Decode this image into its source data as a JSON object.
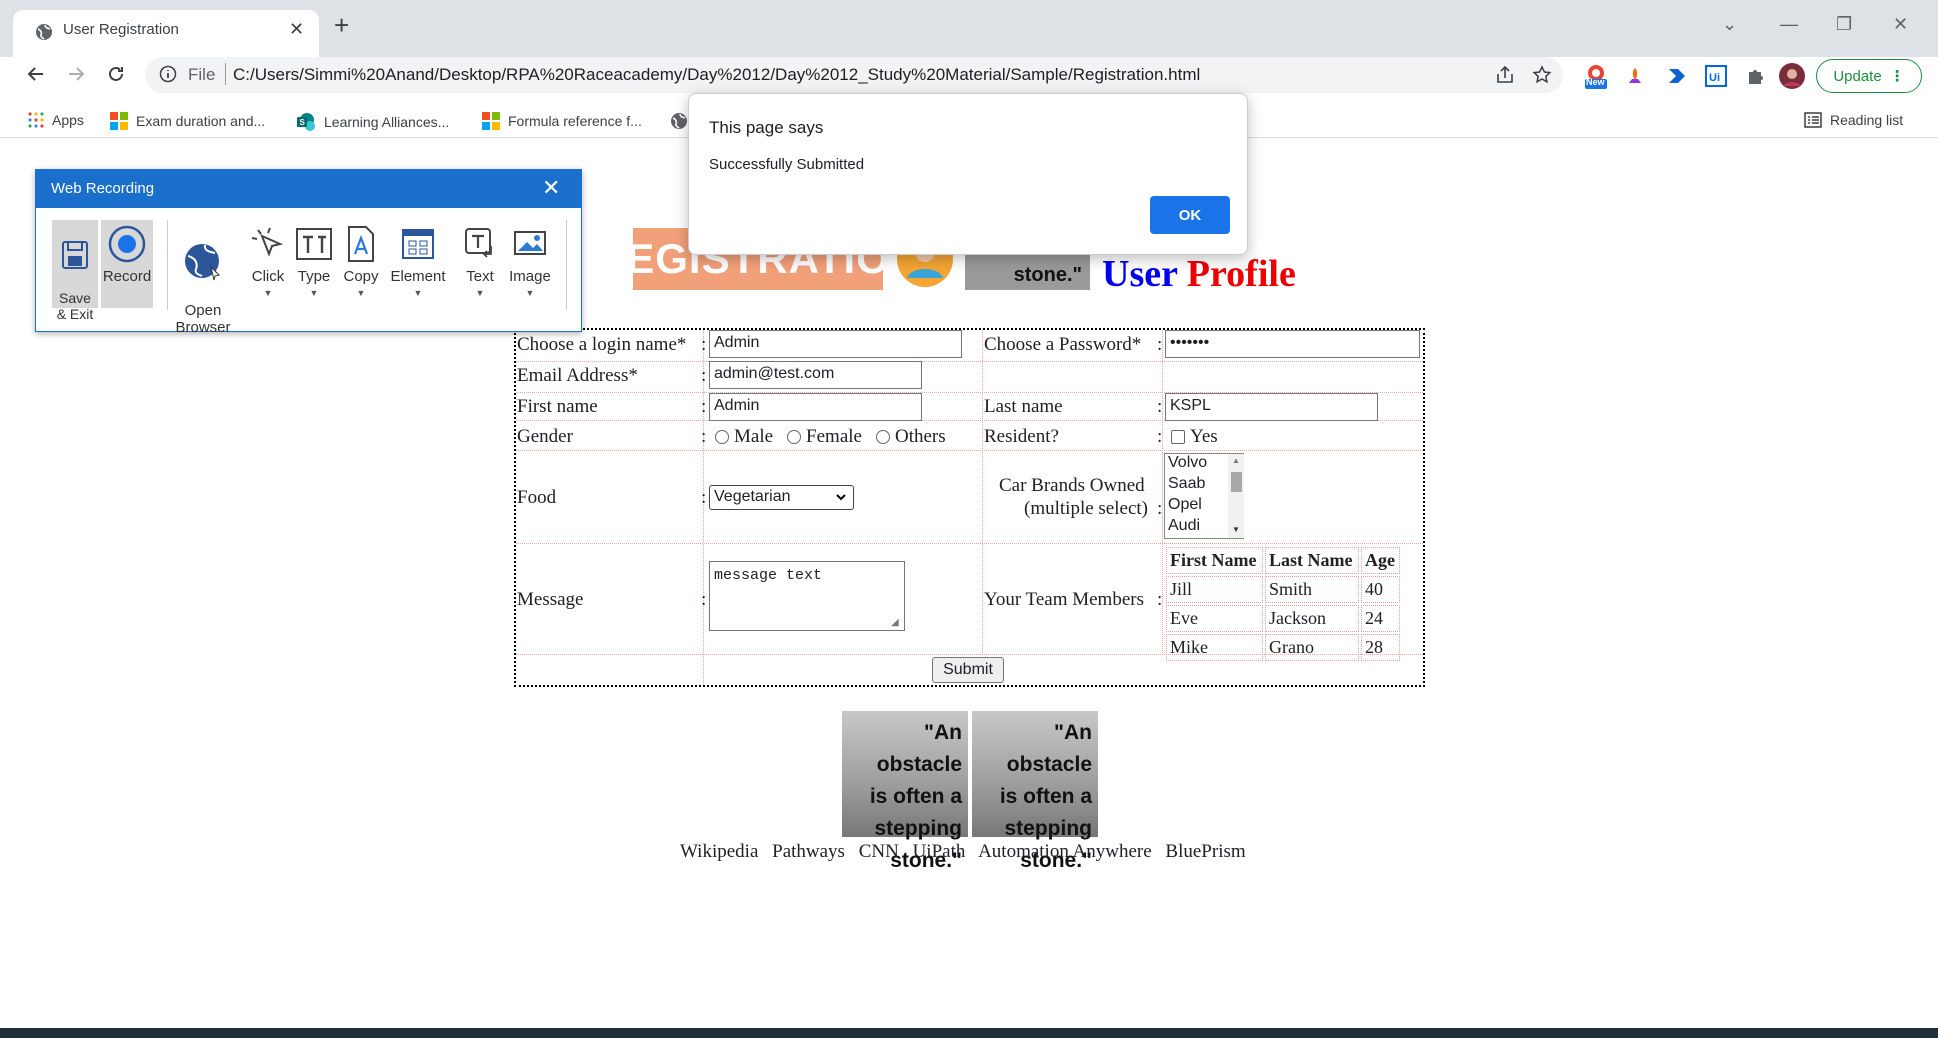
{
  "browser": {
    "tab_title": "User Registration",
    "new_tab_glyph": "+",
    "url_scheme_label": "File",
    "url": "C:/Users/Simmi%20Anand/Desktop/RPA%20Raceacademy/Day%2012/Day%2012_Study%20Material/Sample/Registration.html",
    "update_label": "Update",
    "new_badge": "New",
    "bookmarks": [
      "Apps",
      "Exam duration and...",
      "Learning Alliances...",
      "Formula reference f..."
    ],
    "reading_list": "Reading list"
  },
  "recorder": {
    "title": "Web Recording",
    "buttons": {
      "save_exit": "Save\n& Exit",
      "record": "Record",
      "open_browser": "Open\nBrowser",
      "click": "Click",
      "type": "Type",
      "copy": "Copy",
      "element": "Element",
      "text": "Text",
      "image": "Image"
    }
  },
  "dialog": {
    "heading": "This page says",
    "message": "Successfully Submitted",
    "ok": "OK"
  },
  "header": {
    "registration_banner": "REGISTRATION",
    "title_user": "User",
    "title_profile": "Profile",
    "stone_text": "stone.\""
  },
  "form": {
    "login_label": "Choose a login name*",
    "login_value": "Admin",
    "password_label": "Choose a Password*",
    "password_value": "•••••••",
    "email_label": "Email Address*",
    "email_value": "admin@test.com",
    "firstname_label": "First name",
    "firstname_value": "Admin",
    "lastname_label": "Last name",
    "lastname_value": "KSPL",
    "gender_label": "Gender",
    "gender_options": [
      "Male",
      "Female",
      "Others"
    ],
    "resident_label": "Resident?",
    "resident_option": "Yes",
    "food_label": "Food",
    "food_value": "Vegetarian",
    "car_label_1": "Car Brands Owned",
    "car_label_2": "(multiple select)",
    "car_options": [
      "Volvo",
      "Saab",
      "Opel",
      "Audi"
    ],
    "message_label": "Message",
    "message_value": "message text",
    "team_label": "Your Team Members",
    "colon": ":",
    "team_headers": [
      "First Name",
      "Last Name",
      "Age"
    ],
    "team_rows": [
      [
        "Jill",
        "Smith",
        "40"
      ],
      [
        "Eve",
        "Jackson",
        "24"
      ],
      [
        "Mike",
        "Grano",
        "28"
      ]
    ],
    "submit": "Submit"
  },
  "quote": {
    "line1": "\"An obstacle",
    "line2": "is often a",
    "line3": "stepping",
    "line4": "stone.\""
  },
  "links": [
    "Wikipedia",
    "Pathways",
    "CNN",
    "UiPath",
    "Automation Anywhere",
    "BluePrism"
  ],
  "colors": {
    "title_user": "#0000ee",
    "title_profile": "#ee0000",
    "recorder_header": "#1b6fcc",
    "dialog_ok": "#1a73e8"
  }
}
